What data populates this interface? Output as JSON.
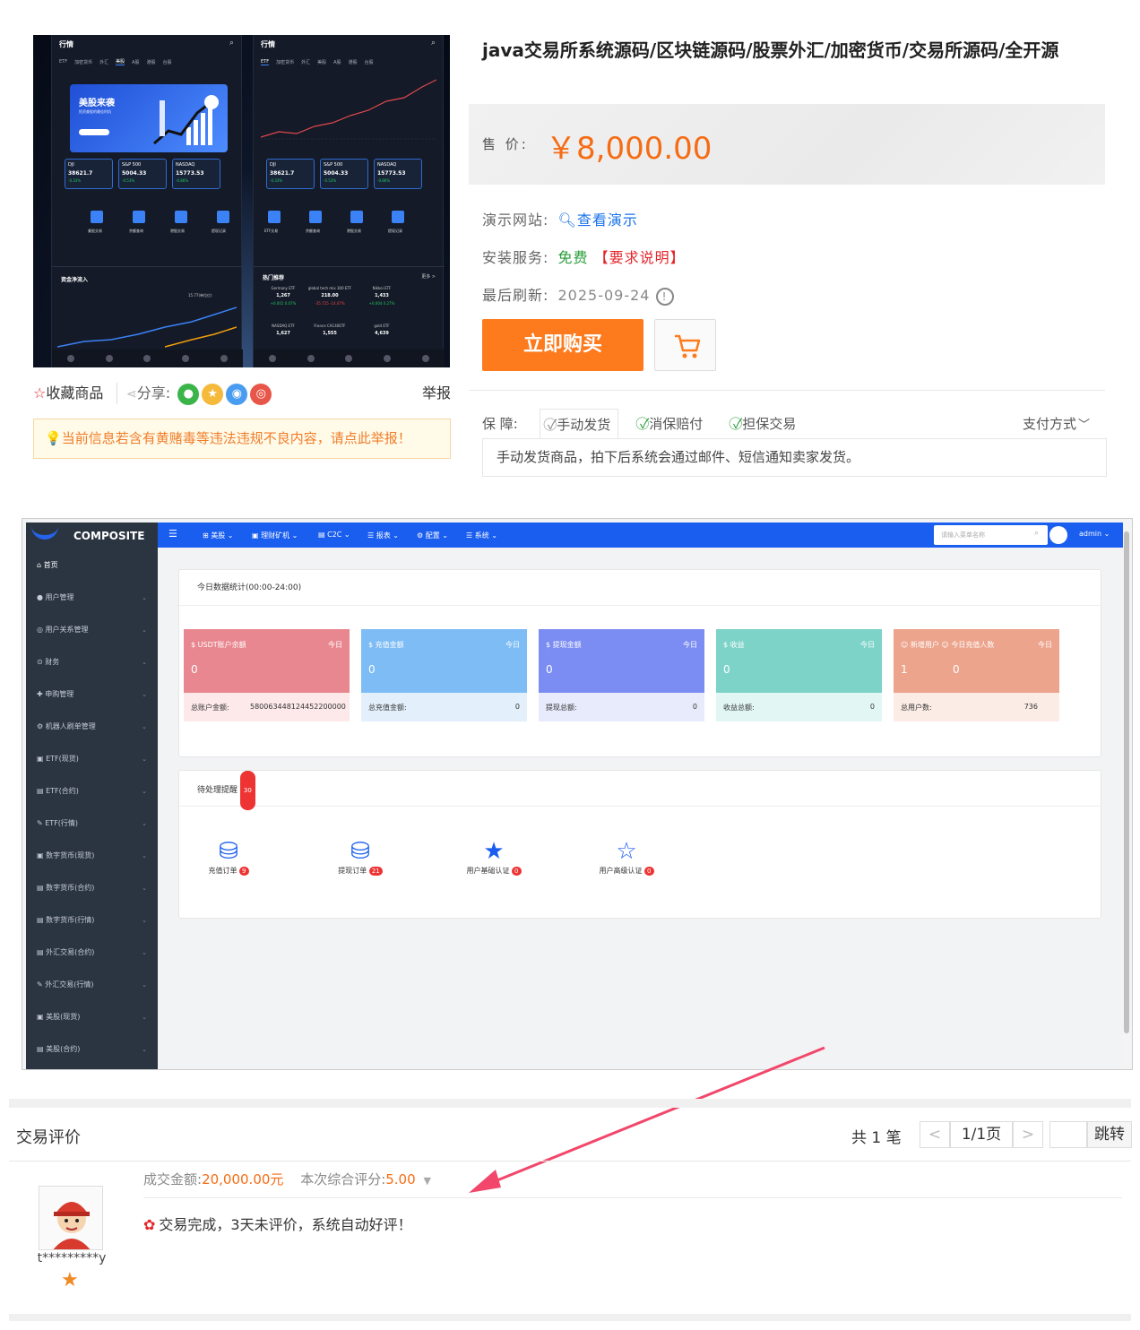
{
  "gallery": {
    "left_phone": {
      "header": "行情",
      "tabs": [
        "ETF",
        "加密货币",
        "外汇",
        "美股",
        "A股",
        "港股",
        "台股"
      ],
      "banner_title": "美股来袭",
      "banner_sub": "投资美股的最佳时机",
      "indices": [
        {
          "name": "DJI",
          "value": "38621.7",
          "change": "-0.33%"
        },
        {
          "name": "S&P 500",
          "value": "5004.33",
          "change": "-0.53%"
        },
        {
          "name": "NASDAQ",
          "value": "15773.53",
          "change": "-0.86%"
        }
      ],
      "icons": [
        "美股交易",
        "余额查询",
        "港股交易",
        "提现记录"
      ],
      "section": "资金净流入",
      "flow_value": "15.77(单位亿)"
    },
    "right_phone": {
      "header": "行情",
      "tabs": [
        "ETF",
        "加密货币",
        "外汇",
        "美股",
        "A股",
        "港股",
        "台股"
      ],
      "indices": [
        {
          "name": "DJI",
          "value": "38621.7",
          "change": "-0.33%"
        },
        {
          "name": "S&P 500",
          "value": "5004.33",
          "change": "-0.53%"
        },
        {
          "name": "NASDAQ",
          "value": "15773.53",
          "change": "-0.86%"
        }
      ],
      "icons": [
        "ETF交易",
        "余额查询",
        "港股交易",
        "提现记录"
      ],
      "section": "热门推荐",
      "more": "更多 >",
      "etfs": [
        {
          "name": "Germany ETF",
          "value": "1,267",
          "change": "+0.001 0.07%"
        },
        {
          "name": "global tech mix 300 ETF",
          "value": "218.00",
          "change": "-35.725 -14.07%"
        },
        {
          "name": "Nikkei ETF",
          "value": "1,433",
          "change": "+0.004 0.27%"
        },
        {
          "name": "NASDAQ ETF",
          "value": "1,627",
          "change": ""
        },
        {
          "name": "France CAC40ETF",
          "value": "1,555",
          "change": ""
        },
        {
          "name": "gold ETF",
          "value": "4,639",
          "change": ""
        }
      ]
    }
  },
  "actions": {
    "favorite": "收藏商品",
    "share": "分享:",
    "report": "举报",
    "warning": "当前信息若含有黄赌毒等违法违规不良内容，请点此举报！"
  },
  "product": {
    "title": "java交易所系统源码/区块链源码/股票外汇/加密货币/交易所源码/全开源",
    "price_label": "售 价:",
    "price": "￥8,000.00",
    "demo_label": "演示网站:",
    "demo_link": "查看演示",
    "install_label": "安装服务:",
    "install_value": "免费",
    "install_note": "【要求说明】",
    "refresh_label": "最后刷新:",
    "refresh_date": "2025-09-24",
    "buy_button": "立即购买",
    "guarantee_label": "保  障:",
    "guarantee_tabs": [
      "手动发货",
      "消保赔付",
      "担保交易"
    ],
    "payment": "支付方式",
    "guarantee_desc": "手动发货商品，拍下后系统会通过邮件、短信通知卖家发货。",
    "colors": {
      "accent": "#f56c14",
      "buy": "#fe7b1d",
      "free": "#2a9d3a",
      "note": "#e4262b",
      "link": "#1a73e8"
    }
  },
  "admin": {
    "brand": "COMPOSITE",
    "sidebar": [
      "首页",
      "用户管理",
      "用户关系管理",
      "财务",
      "申购管理",
      "机器人刷单管理",
      "ETF(现货)",
      "ETF(合约)",
      "ETF(行情)",
      "数字货币(现货)",
      "数字货币(合约)",
      "数字货币(行情)",
      "外汇交易(合约)",
      "外汇交易(行情)",
      "美股(现货)",
      "美股(合约)"
    ],
    "top_menu": [
      "美股",
      "理财矿机",
      "C2C",
      "报表",
      "配置",
      "系统"
    ],
    "search_placeholder": "请输入菜单名称",
    "user": "admin",
    "stats_title": "今日数据统计(00:00-24:00)",
    "stats": [
      {
        "name": "USDT账户余额",
        "tag": "今日",
        "value": "0",
        "foot_label": "总账户金额:",
        "foot_value": "580063448124452200000",
        "color": "#e8878f",
        "foot_bg": "#fde9ea"
      },
      {
        "name": "充值金额",
        "tag": "今日",
        "value": "0",
        "foot_label": "总充值金额:",
        "foot_value": "0",
        "color": "#7dbcf5",
        "foot_bg": "#e3f0fc"
      },
      {
        "name": "提现金额",
        "tag": "今日",
        "value": "0",
        "foot_label": "提现总额:",
        "foot_value": "0",
        "color": "#7b8cf2",
        "foot_bg": "#e8ebfc"
      },
      {
        "name": "收益",
        "tag": "今日",
        "value": "0",
        "foot_label": "收益总额:",
        "foot_value": "0",
        "color": "#7ed3c9",
        "foot_bg": "#e2f7f4"
      },
      {
        "name": "新增用户",
        "name2": "今日充值人数",
        "tag": "今日",
        "value": "1",
        "value2": "0",
        "foot_label": "总用户数:",
        "foot_value": "736",
        "color": "#eca48c",
        "foot_bg": "#fcece6"
      }
    ],
    "pending_title": "待处理提醒",
    "pending_count": "30",
    "pending": [
      {
        "label": "充值订单",
        "count": "9"
      },
      {
        "label": "提现订单",
        "count": "21"
      },
      {
        "label": "用户基础认证",
        "count": "0"
      },
      {
        "label": "用户高级认证",
        "count": "0"
      }
    ]
  },
  "reviews": {
    "title": "交易评价",
    "total": "共 1 笔",
    "prev": "<",
    "page": "1/1页",
    "next": ">",
    "jump": "跳转",
    "amount_label": "成交金额:",
    "amount": "20,000.00元",
    "score_label": "本次综合评分:",
    "score": "5.00",
    "text": "交易完成，3天未评价，系统自动好评！",
    "user": "t*********y"
  }
}
